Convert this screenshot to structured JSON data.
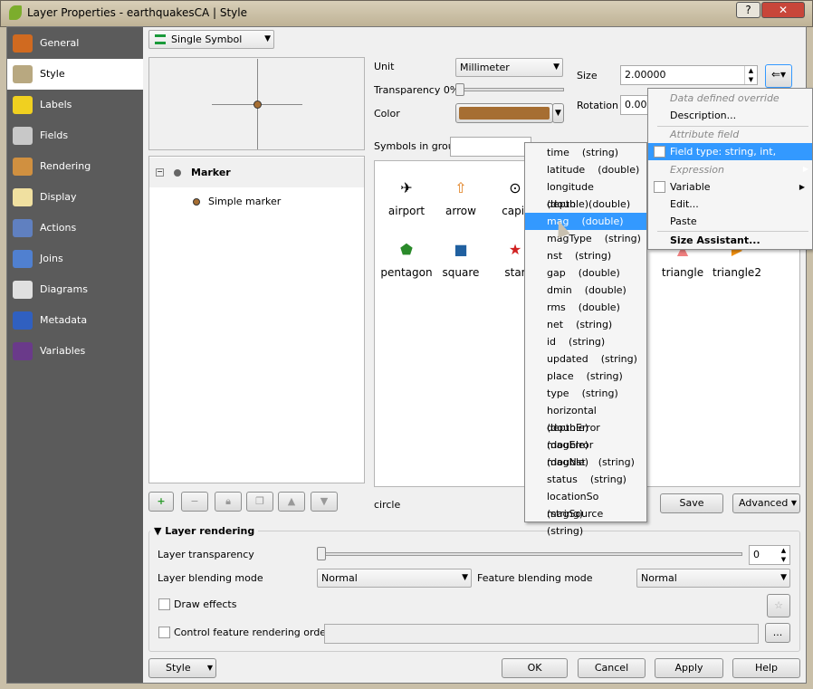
{
  "window": {
    "title": "Layer Properties - earthquakesCA | Style",
    "help": "?",
    "close": "✕"
  },
  "sidebar": {
    "items": [
      {
        "label": "General",
        "icon": "tools-icon",
        "color": "#d06a20"
      },
      {
        "label": "Style",
        "icon": "paintbrush-icon",
        "color": "#b8a880"
      },
      {
        "label": "Labels",
        "icon": "abc-label-icon",
        "color": "#f0d020"
      },
      {
        "label": "Fields",
        "icon": "table-icon",
        "color": "#c8c8c8"
      },
      {
        "label": "Rendering",
        "icon": "brush-icon",
        "color": "#d09040"
      },
      {
        "label": "Display",
        "icon": "speech-bubble-icon",
        "color": "#f0e0a0"
      },
      {
        "label": "Actions",
        "icon": "gear-icon",
        "color": "#6080c0"
      },
      {
        "label": "Joins",
        "icon": "join-icon",
        "color": "#5080d0"
      },
      {
        "label": "Diagrams",
        "icon": "diagram-icon",
        "color": "#e0e0e0"
      },
      {
        "label": "Metadata",
        "icon": "info-icon",
        "color": "#3060c0"
      },
      {
        "label": "Variables",
        "icon": "epsilon-icon",
        "color": "#6a3a8a"
      }
    ],
    "selected": "Style"
  },
  "renderer": {
    "value": "Single Symbol"
  },
  "tree": {
    "root": "Marker",
    "child": "Simple marker"
  },
  "props": {
    "unit_label": "Unit",
    "unit": "Millimeter",
    "transparency_label": "Transparency 0%",
    "transparency": 0,
    "color_label": "Color",
    "color": "#a66e32",
    "size_label": "Size",
    "size": "2.00000",
    "rotation_label": "Rotation",
    "rotation": "0.00",
    "symbols_group_label": "Symbols in group"
  },
  "symbols": [
    {
      "name": "airport",
      "glyph": "✈"
    },
    {
      "name": "arrow",
      "glyph": "⇧"
    },
    {
      "name": "capit",
      "glyph": "⊙"
    },
    {
      "name": "pentagon",
      "glyph": "⬟"
    },
    {
      "name": "square",
      "glyph": "■"
    },
    {
      "name": "star",
      "glyph": "★"
    },
    {
      "name": "triangle",
      "glyph": "▲"
    },
    {
      "name": "triangle2",
      "glyph": "▶"
    }
  ],
  "symbol_footer": {
    "name": "circle",
    "save": "Save",
    "advanced": "Advanced"
  },
  "dd_menu": {
    "header1": "Data defined override",
    "description": "Description...",
    "header2": "Attribute field",
    "field_type": "Field type: string, int, double",
    "header3": "Expression",
    "variable": "Variable",
    "edit": "Edit...",
    "paste": "Paste",
    "size_assistant": "Size Assistant..."
  },
  "fields": [
    {
      "name": "time",
      "type": "(string)"
    },
    {
      "name": "latitude",
      "type": "(double)"
    },
    {
      "name": "longitude",
      "type": "(double)"
    },
    {
      "name": "depth",
      "type": "(double)"
    },
    {
      "name": "mag",
      "type": "(double)"
    },
    {
      "name": "magType",
      "type": "(string)"
    },
    {
      "name": "nst",
      "type": "(string)"
    },
    {
      "name": "gap",
      "type": "(double)"
    },
    {
      "name": "dmin",
      "type": "(double)"
    },
    {
      "name": "rms",
      "type": "(double)"
    },
    {
      "name": "net",
      "type": "(string)"
    },
    {
      "name": "id",
      "type": "(string)"
    },
    {
      "name": "updated",
      "type": "(string)"
    },
    {
      "name": "place",
      "type": "(string)"
    },
    {
      "name": "type",
      "type": "(string)"
    },
    {
      "name": "horizontal",
      "type": "(double)"
    },
    {
      "name": "depthError",
      "type": "(double)"
    },
    {
      "name": "magError",
      "type": "(double)"
    },
    {
      "name": "magNst",
      "type": "(string)"
    },
    {
      "name": "status",
      "type": "(string)"
    },
    {
      "name": "locationSo",
      "type": "(string)"
    },
    {
      "name": "magSource",
      "type": "(string)"
    }
  ],
  "fields_highlighted": "mag",
  "layer_rendering": {
    "title": "Layer rendering",
    "transparency_label": "Layer transparency",
    "transparency": "0",
    "blend_label": "Layer blending mode",
    "blend": "Normal",
    "feature_blend_label": "Feature blending mode",
    "feature_blend": "Normal",
    "draw_effects": "Draw effects",
    "render_order": "Control feature rendering order",
    "ellipsis": "..."
  },
  "footer": {
    "style": "Style",
    "ok": "OK",
    "cancel": "Cancel",
    "apply": "Apply",
    "help": "Help"
  }
}
